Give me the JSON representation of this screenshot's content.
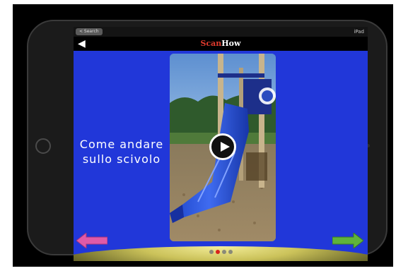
{
  "status_bar": {
    "back_label": "< Search",
    "device_label": "iPad"
  },
  "nav": {
    "back_icon": "chevron-left-icon",
    "logo_part1": "Scan",
    "logo_part2": "How"
  },
  "content": {
    "title_line1": "Come andare",
    "title_line2": "sullo scivolo"
  },
  "video": {
    "play_icon": "play-icon"
  },
  "navigation": {
    "prev_icon": "arrow-left-icon",
    "next_icon": "arrow-right-icon",
    "page_count": 4,
    "active_page": 2
  },
  "colors": {
    "screen_background": "#2137d9",
    "prev_arrow": "#e05aa8",
    "next_arrow": "#5fb33a",
    "active_dot": "#d8241c"
  }
}
